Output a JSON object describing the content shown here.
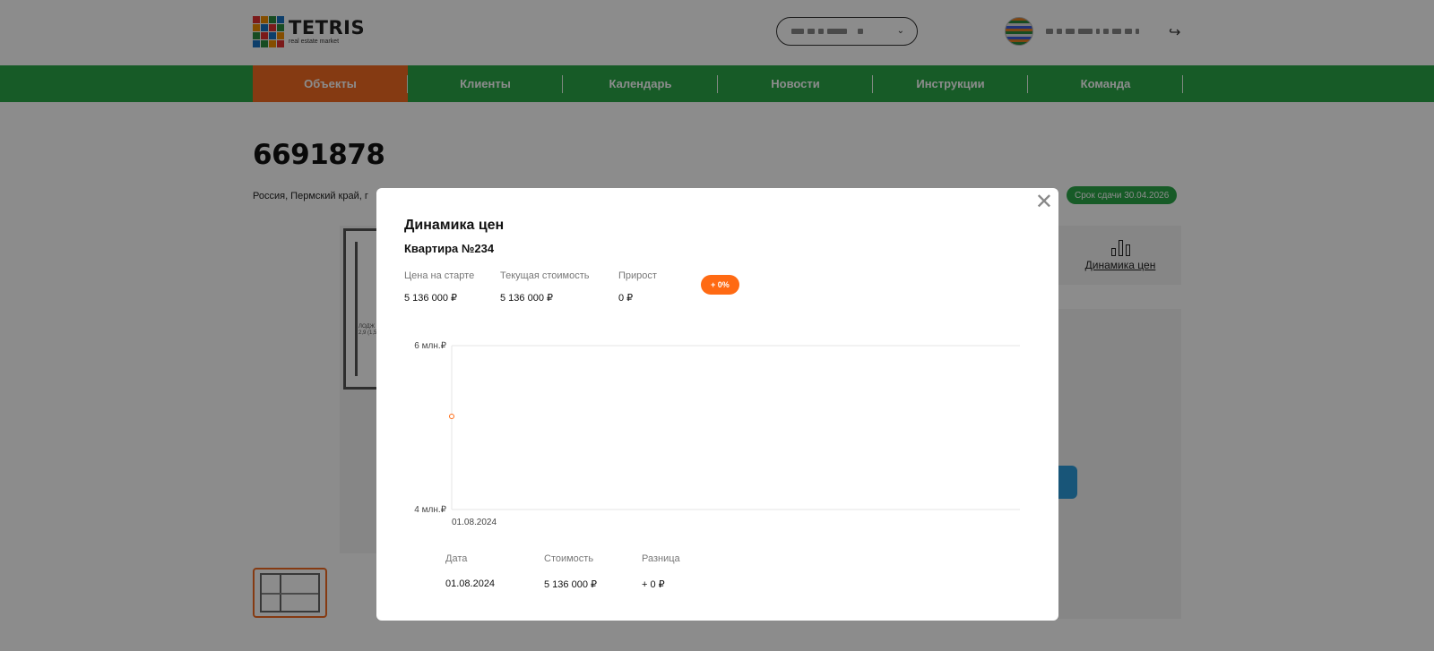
{
  "header": {
    "logo": {
      "name": "TETRIS",
      "subtitle": "real estate market",
      "bar_colors": [
        "#e03131",
        "#f08c00",
        "#2b8a3e",
        "#1971c2",
        "#f08c00",
        "#1971c2",
        "#e03131",
        "#2b8a3e",
        "#2b8a3e",
        "#e03131",
        "#1971c2",
        "#f08c00",
        "#1971c2",
        "#2b8a3e",
        "#f08c00",
        "#e03131"
      ]
    },
    "city_select_icon": "chevron-down-icon",
    "logout_icon": "logout-icon"
  },
  "nav": {
    "items": [
      {
        "label": "Объекты",
        "active": true
      },
      {
        "label": "Клиенты",
        "active": false
      },
      {
        "label": "Календарь",
        "active": false
      },
      {
        "label": "Новости",
        "active": false
      },
      {
        "label": "Инструкции",
        "active": false
      },
      {
        "label": "Команда",
        "active": false
      }
    ],
    "color": "#2aa748",
    "active_color": "#f26b21"
  },
  "object": {
    "id": "6691878",
    "address": "Россия, Пермский край, г",
    "deadline": "Срок сдачи 30.04.2026",
    "price_dynamics_link": "Динамика цен"
  },
  "modal": {
    "title": "Динамика цен",
    "subtitle": "Квартира №234",
    "stats": {
      "start_label": "Цена на старте",
      "start_value": "5 136 000 ₽",
      "current_label": "Текущая стоимость",
      "current_value": "5 136 000 ₽",
      "growth_label": "Прирост",
      "growth_value": "0 ₽",
      "growth_percent": "+ 0%"
    },
    "table": {
      "headers": [
        "Дата",
        "Стоимость",
        "Разница"
      ],
      "rows": [
        [
          "01.08.2024",
          "5 136 000 ₽",
          "+ 0 ₽"
        ]
      ]
    },
    "close_icon": "close-icon"
  },
  "chart_data": {
    "type": "line",
    "x": [
      "01.08.2024"
    ],
    "series": [
      {
        "values": [
          5136000
        ]
      }
    ],
    "ylim": [
      4000000,
      6000000
    ],
    "y_ticks": [
      {
        "value": 6000000,
        "label": "6 млн.₽"
      },
      {
        "value": 4000000,
        "label": "4 млн.₽"
      }
    ],
    "x_ticks": [
      "01.08.2024"
    ],
    "grid": true,
    "color": "#ff6a13"
  }
}
